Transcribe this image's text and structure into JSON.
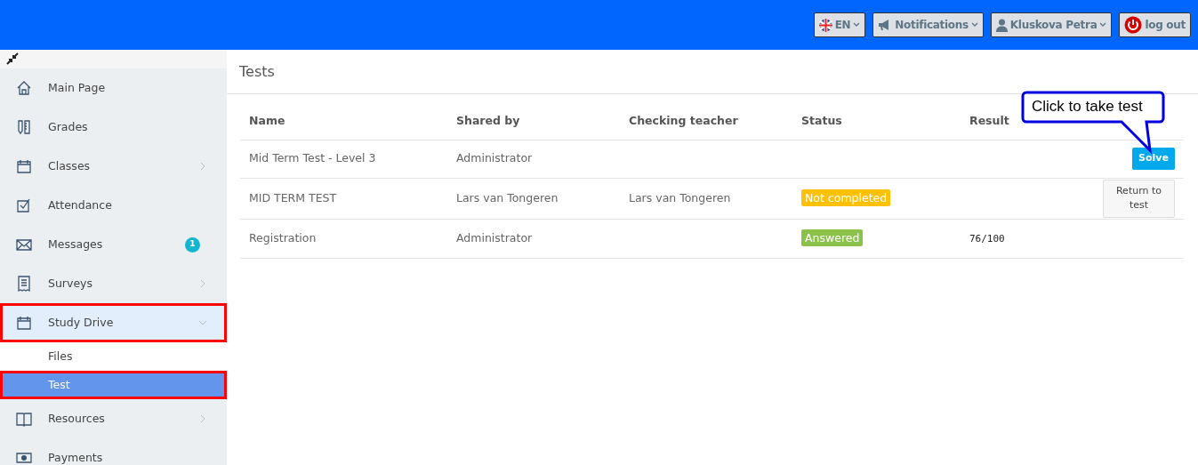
{
  "header": {
    "buttons": [
      {
        "kind": "language",
        "label": "EN"
      },
      {
        "kind": "notifications",
        "label": "Notifications"
      },
      {
        "kind": "user",
        "label": "Kluskova Petra"
      },
      {
        "kind": "logout",
        "label": "log out"
      }
    ]
  },
  "sidebar": {
    "items": [
      {
        "label": "Main Page"
      },
      {
        "label": "Grades"
      },
      {
        "label": "Classes",
        "expanded": false
      },
      {
        "label": "Attendance"
      },
      {
        "label": "Messages",
        "badge": "1"
      },
      {
        "label": "Surveys",
        "expanded": false
      },
      {
        "label": "Study Drive",
        "expanded": true,
        "highlighted": true,
        "children": [
          {
            "label": "Files",
            "selected": false,
            "highlighted": false
          },
          {
            "label": "Test",
            "selected": true,
            "highlighted": true
          }
        ]
      },
      {
        "label": "Resources",
        "expanded": false
      },
      {
        "label": "Payments"
      }
    ]
  },
  "page": {
    "title": "Tests"
  },
  "table": {
    "columns": [
      "Name",
      "Shared by",
      "Checking teacher",
      "Status",
      "Result"
    ],
    "rows": [
      {
        "name": "Mid Term Test - Level 3",
        "shared_by": "Administrator",
        "action": {
          "kind": "primary",
          "label": "Solve"
        }
      },
      {
        "name": "MID TERM TEST",
        "shared_by": "Lars van Tongeren",
        "checking_teacher": "Lars van Tongeren",
        "status": {
          "kind": "warning",
          "label": "Not completed"
        },
        "action": {
          "kind": "default",
          "label": "Return to test"
        }
      },
      {
        "name": "Registration",
        "shared_by": "Administrator",
        "status": {
          "kind": "success",
          "label": "Answered"
        },
        "result": "76/100"
      }
    ]
  },
  "callout": {
    "text": "Click to take test"
  }
}
